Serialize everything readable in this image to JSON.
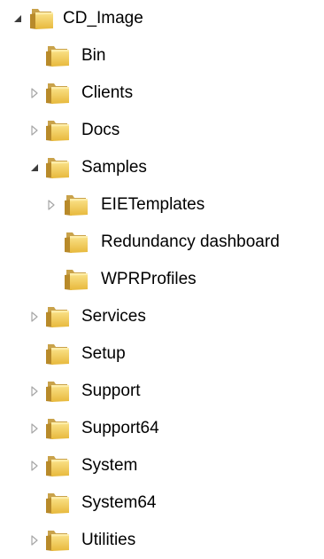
{
  "tree": {
    "root": {
      "label": "CD_Image",
      "state": "expanded"
    },
    "items": [
      {
        "label": "Bin"
      },
      {
        "label": "Clients",
        "state": "collapsed"
      },
      {
        "label": "Docs",
        "state": "collapsed"
      },
      {
        "label": "Samples",
        "state": "expanded",
        "children": [
          {
            "label": "EIETemplates",
            "state": "collapsed"
          },
          {
            "label": "Redundancy dashboard"
          },
          {
            "label": "WPRProfiles"
          }
        ]
      },
      {
        "label": "Services",
        "state": "collapsed"
      },
      {
        "label": "Setup"
      },
      {
        "label": "Support",
        "state": "collapsed"
      },
      {
        "label": "Support64",
        "state": "collapsed"
      },
      {
        "label": "System",
        "state": "collapsed"
      },
      {
        "label": "System64"
      },
      {
        "label": "Utilities",
        "state": "collapsed"
      }
    ]
  },
  "icons": {
    "folder": "folder-icon",
    "expanded": "expanded-arrow-icon",
    "collapsed": "collapsed-arrow-icon"
  },
  "colors": {
    "folder_back": "#c9a24a",
    "folder_front": "#f2cf62",
    "arrow_expanded": "#3c3c3c",
    "arrow_collapsed": "#a6a6a6"
  }
}
